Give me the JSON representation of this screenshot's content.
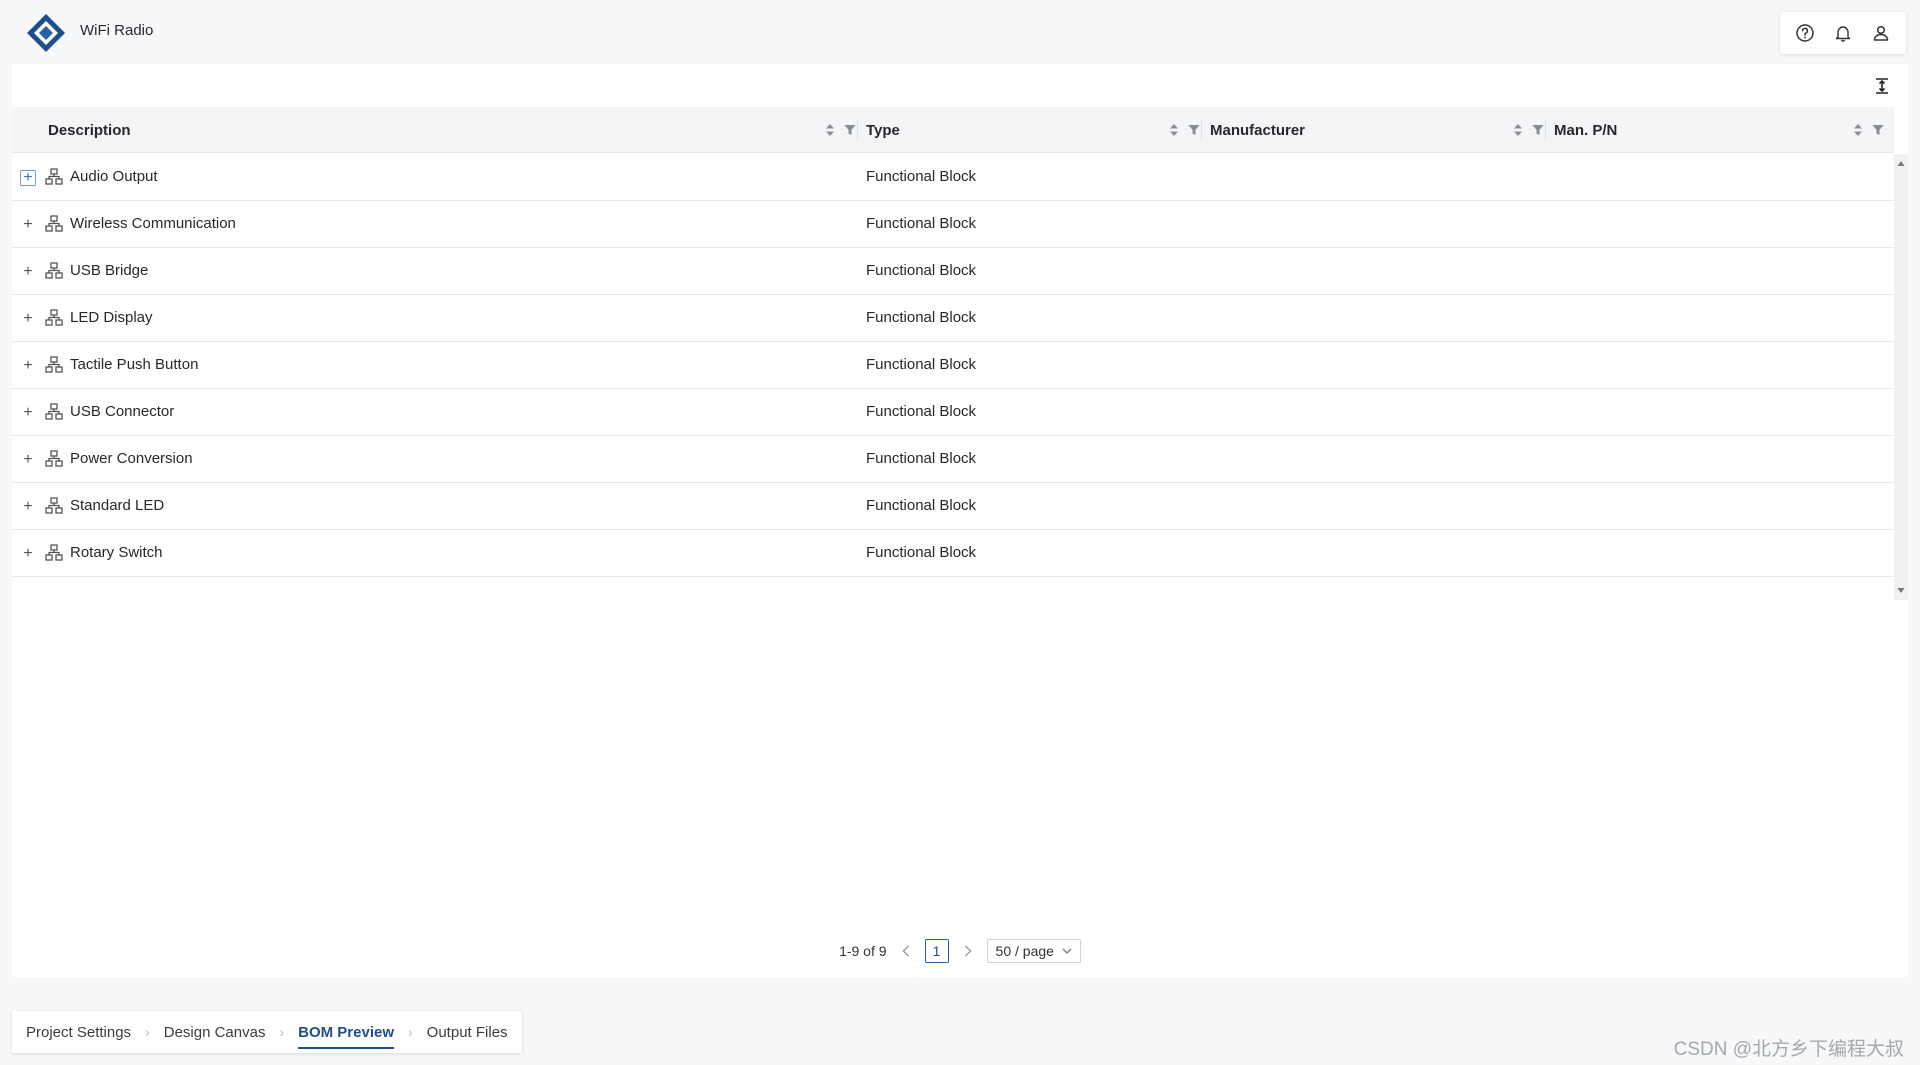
{
  "app": {
    "title": "WiFi Radio"
  },
  "header": {
    "icons": [
      "help-icon",
      "bell-icon",
      "user-icon"
    ]
  },
  "table": {
    "columns": [
      {
        "key": "description",
        "label": "Description"
      },
      {
        "key": "type",
        "label": "Type"
      },
      {
        "key": "manufacturer",
        "label": "Manufacturer"
      },
      {
        "key": "man_pn",
        "label": "Man. P/N"
      }
    ],
    "rows": [
      {
        "description": "Audio Output",
        "type": "Functional Block"
      },
      {
        "description": "Wireless Communication",
        "type": "Functional Block"
      },
      {
        "description": "USB Bridge",
        "type": "Functional Block"
      },
      {
        "description": "LED Display",
        "type": "Functional Block"
      },
      {
        "description": "Tactile Push Button",
        "type": "Functional Block"
      },
      {
        "description": "USB Connector",
        "type": "Functional Block"
      },
      {
        "description": "Power Conversion",
        "type": "Functional Block"
      },
      {
        "description": "Standard LED",
        "type": "Functional Block"
      },
      {
        "description": "Rotary Switch",
        "type": "Functional Block"
      }
    ]
  },
  "pagination": {
    "range": "1-9 of 9",
    "current_page": "1",
    "page_size": "50 / page"
  },
  "steps": [
    {
      "label": "Project Settings",
      "active": false
    },
    {
      "label": "Design Canvas",
      "active": false
    },
    {
      "label": "BOM Preview",
      "active": true
    },
    {
      "label": "Output Files",
      "active": false
    }
  ],
  "watermark": "CSDN @北方乡下编程大叔",
  "colors": {
    "accent": "#1f4e8f",
    "logo": "#2b5fa5"
  }
}
